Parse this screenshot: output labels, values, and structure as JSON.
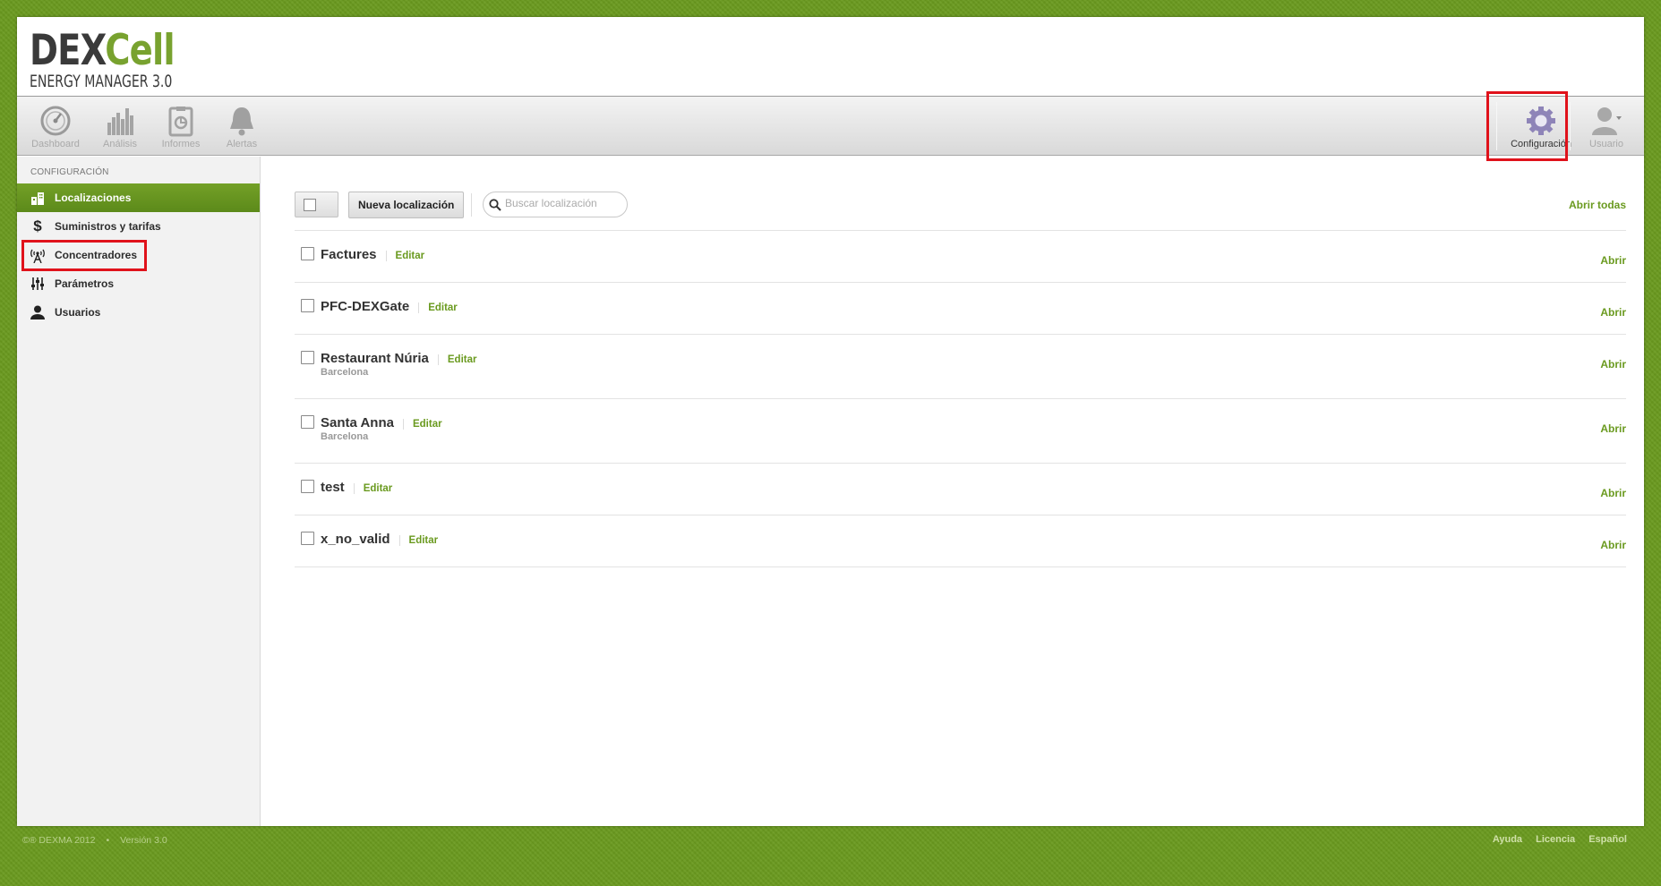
{
  "logo": {
    "part1": "DEX",
    "part2": "Cell",
    "subtitle": "ENERGY MANAGER 3.0"
  },
  "toolbar": {
    "left": [
      {
        "label": "Dashboard",
        "icon": "dashboard-gauge-icon"
      },
      {
        "label": "Análisis",
        "icon": "analysis-bars-icon"
      },
      {
        "label": "Informes",
        "icon": "reports-clipboard-icon"
      },
      {
        "label": "Alertas",
        "icon": "alerts-bell-icon"
      }
    ],
    "settings": {
      "label": "Configuración",
      "icon": "gear-icon"
    },
    "user": {
      "label": "Usuario",
      "icon": "user-dropdown-icon"
    }
  },
  "sidebar": {
    "heading": "CONFIGURACIÓN",
    "items": [
      {
        "label": "Localizaciones",
        "icon": "buildings-icon",
        "active": true
      },
      {
        "label": "Suministros y tarifas",
        "icon": "dollar-icon",
        "active": false
      },
      {
        "label": "Concentradores",
        "icon": "antenna-icon",
        "active": false
      },
      {
        "label": "Parámetros",
        "icon": "sliders-icon",
        "active": false
      },
      {
        "label": "Usuarios",
        "icon": "person-icon",
        "active": false
      }
    ]
  },
  "main": {
    "new_button": "Nueva localización",
    "search_placeholder": "Buscar localización",
    "open_all": "Abrir todas",
    "edit_label": "Editar",
    "open_label": "Abrir",
    "locations": [
      {
        "name": "Factures",
        "city": ""
      },
      {
        "name": "PFC-DEXGate",
        "city": ""
      },
      {
        "name": "Restaurant Núria",
        "city": "Barcelona"
      },
      {
        "name": "Santa Anna",
        "city": "Barcelona"
      },
      {
        "name": "test",
        "city": ""
      },
      {
        "name": "x_no_valid",
        "city": ""
      }
    ]
  },
  "footer": {
    "copyright": "©® DEXMA 2012",
    "version": "Versión 3.0",
    "links": [
      "Ayuda",
      "Licencia",
      "Español"
    ]
  },
  "colors": {
    "accent": "#6a9a1f",
    "highlight": "#e0121b",
    "active_nav": "#67951f"
  }
}
